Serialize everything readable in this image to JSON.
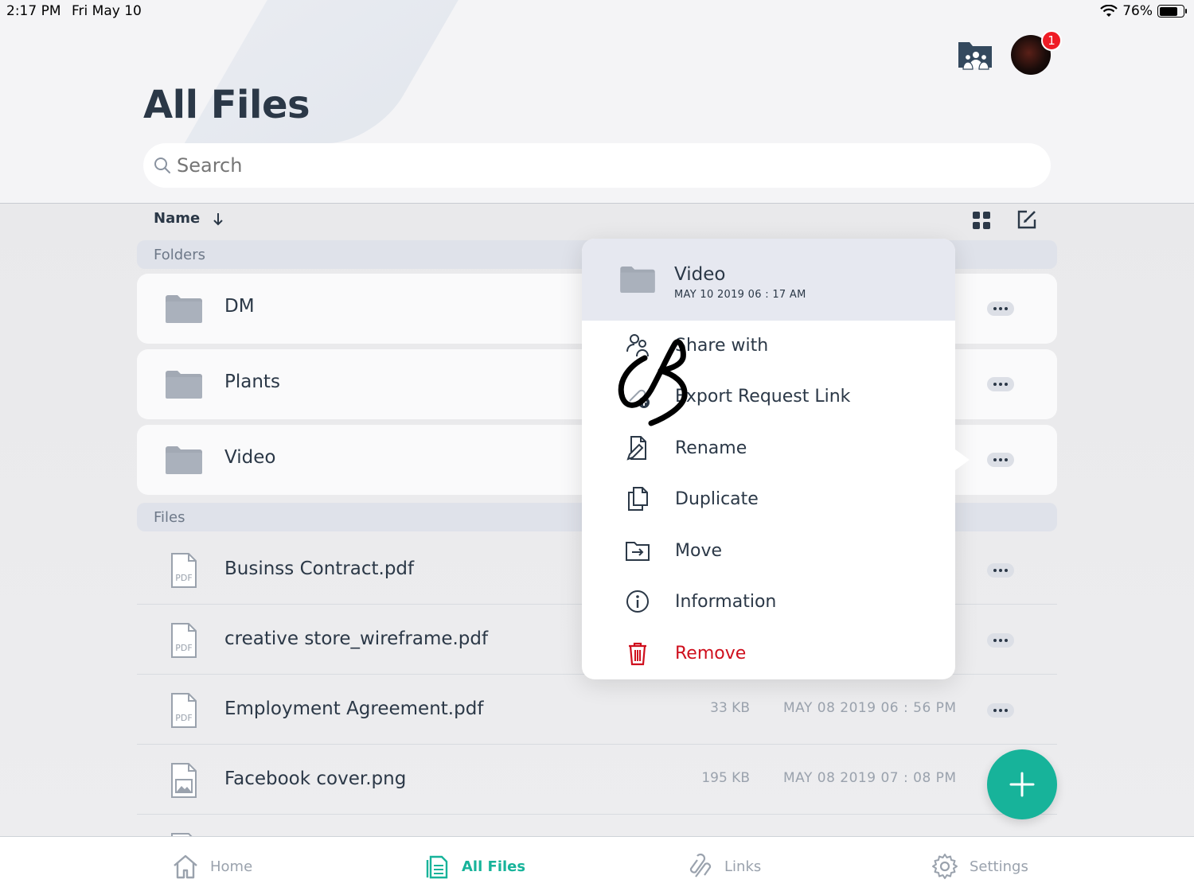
{
  "status_bar": {
    "time": "2:17 PM",
    "date": "Fri May 10",
    "battery": "76%",
    "battery_level": 0.76
  },
  "header": {
    "notification_count": "1"
  },
  "page_title": "All Files",
  "search": {
    "placeholder": "Search"
  },
  "sort": {
    "label": "Name"
  },
  "sections": {
    "folders": "Folders",
    "files": "Files"
  },
  "folders": [
    {
      "name": "DM"
    },
    {
      "name": "Plants"
    },
    {
      "name": "Video"
    }
  ],
  "files": [
    {
      "name": "Businss Contract.pdf",
      "size": "",
      "date": "",
      "icon": "pdf-file-icon"
    },
    {
      "name": "creative store_wireframe.pdf",
      "size": "",
      "date": "",
      "icon": "pdf-file-icon"
    },
    {
      "name": "Employment Agreement.pdf",
      "size": "33 KB",
      "date": "MAY 08 2019 06 : 56 PM",
      "icon": "pdf-file-icon"
    },
    {
      "name": "Facebook cover.png",
      "size": "195 KB",
      "date": "MAY 08 2019 07 : 08 PM",
      "icon": "image-file-icon"
    }
  ],
  "context_menu": {
    "title": "Video",
    "subtitle": "MAY 10 2019 06 : 17 AM",
    "items": [
      {
        "label": "Share with",
        "icon": "share-people-icon"
      },
      {
        "label": "Export Request Link",
        "icon": "export-link-icon"
      },
      {
        "label": "Rename",
        "icon": "rename-icon"
      },
      {
        "label": "Duplicate",
        "icon": "duplicate-icon"
      },
      {
        "label": "Move",
        "icon": "move-icon"
      },
      {
        "label": "Information",
        "icon": "info-icon"
      },
      {
        "label": "Remove",
        "icon": "trash-icon"
      }
    ]
  },
  "tabs": [
    {
      "label": "Home",
      "icon": "home-icon",
      "active": false
    },
    {
      "label": "All Files",
      "icon": "files-icon",
      "active": true
    },
    {
      "label": "Links",
      "icon": "links-icon",
      "active": false
    },
    {
      "label": "Settings",
      "icon": "gear-icon",
      "active": false
    }
  ],
  "colors": {
    "accent": "#17b39a",
    "danger": "#cf0f1d",
    "text": "#2b3847",
    "badge": "#ef1c25"
  }
}
